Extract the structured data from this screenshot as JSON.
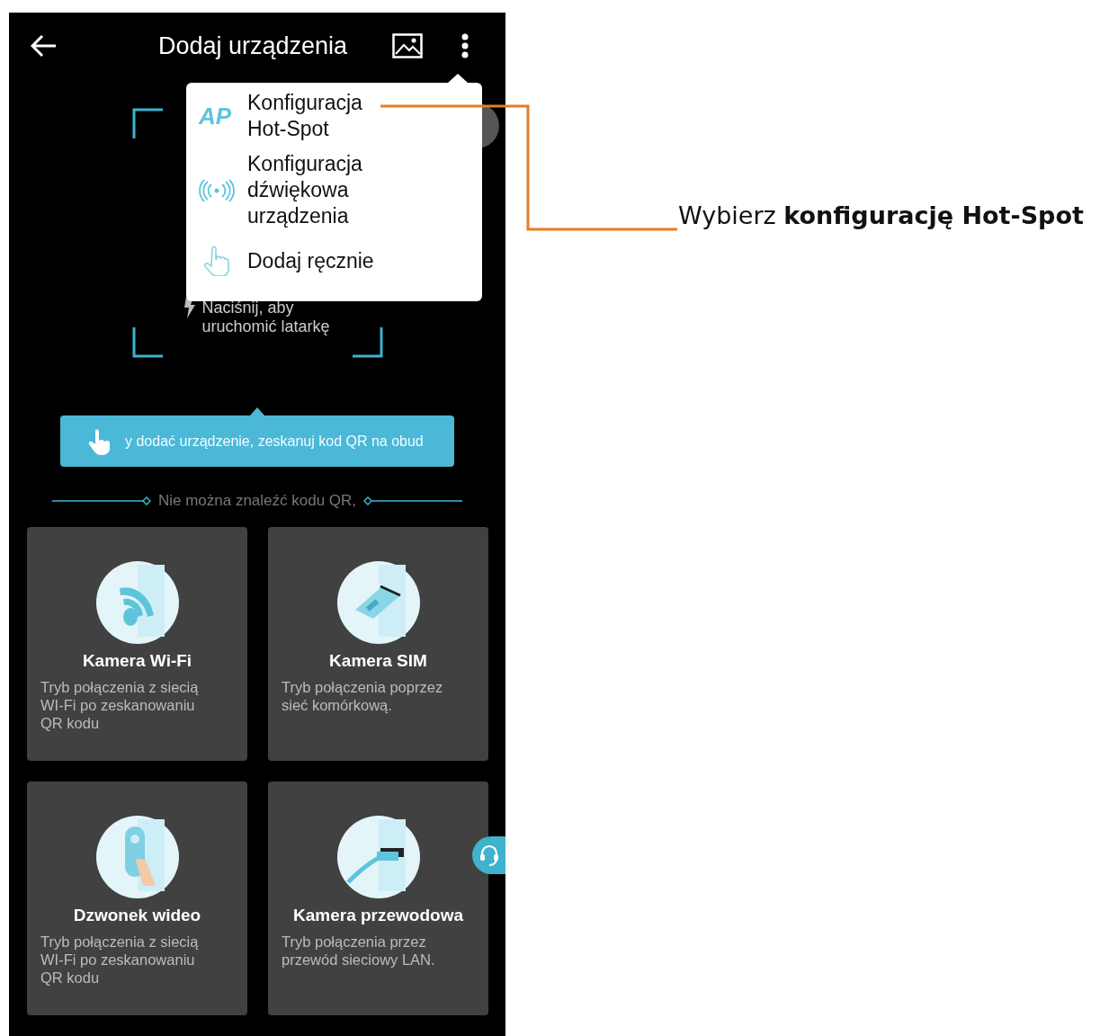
{
  "app_bar": {
    "title": "Dodaj urządzenia"
  },
  "menu": {
    "items": [
      {
        "kind": "ap",
        "icon_text": "AP",
        "label": "Konfiguracja\nHot-Spot"
      },
      {
        "kind": "sound",
        "label": "Konfiguracja\ndźwiękowa\nurządzenia"
      },
      {
        "kind": "manual",
        "label": "Dodaj ręcznie"
      }
    ]
  },
  "scanner": {
    "flashlight_hint": "Naciśnij, aby\nuruchomić latarkę"
  },
  "tip": {
    "text": "y dodać urządzenie, zeskanuj kod QR na obud"
  },
  "divider_text": "Nie można znaleźć kodu QR,",
  "device_types": [
    {
      "kind": "wifi",
      "title": "Kamera Wi-Fi",
      "description": "Tryb połączenia z siecią WI-Fi po zeskanowaniu QR kodu"
    },
    {
      "kind": "sim",
      "title": "Kamera SIM",
      "description": "Tryb połączenia poprzez sieć komórkową."
    },
    {
      "kind": "doorbell",
      "title": "Dzwonek wideo",
      "description": "Tryb połączenia z siecią WI-Fi po zeskanowaniu QR kodu"
    },
    {
      "kind": "cable",
      "title": "Kamera przewodowa",
      "description": "Tryb połączenia przez przewód sieciowy LAN."
    }
  ],
  "annotation": {
    "text": "Wybierz **konfigurację Hot-Spot**"
  }
}
